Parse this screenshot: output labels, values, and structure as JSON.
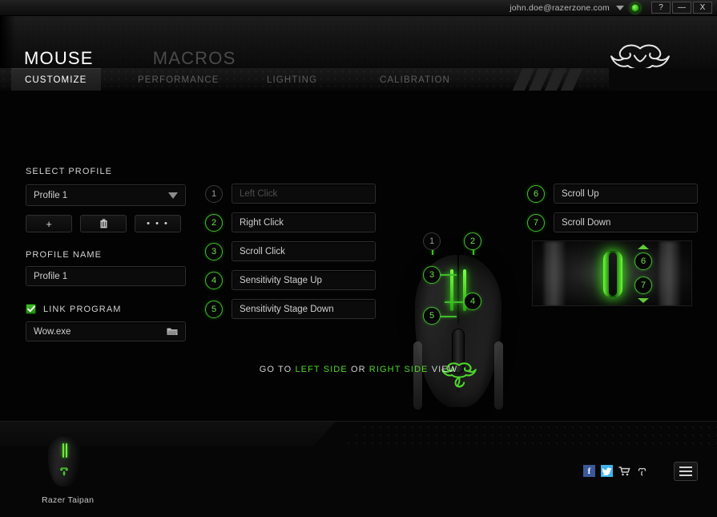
{
  "titlebar": {
    "email": "john.doe@razerzone.com",
    "caret_icon": "chevron-down-icon",
    "status_icon": "online-status-indicator",
    "help_label": "?",
    "minimize_label": "—",
    "close_label": "X"
  },
  "header": {
    "main_tabs": [
      {
        "label": "MOUSE",
        "active": true
      },
      {
        "label": "MACROS",
        "active": false
      }
    ],
    "logo_icon": "razer-logo-icon"
  },
  "sub_tabs": [
    {
      "label": "CUSTOMIZE",
      "active": true
    },
    {
      "label": "PERFORMANCE",
      "active": false
    },
    {
      "label": "LIGHTING",
      "active": false
    },
    {
      "label": "CALIBRATION",
      "active": false
    }
  ],
  "profile_panel": {
    "select_profile_label": "SELECT PROFILE",
    "selected_profile": "Profile 1",
    "add_button_label": "+",
    "delete_button_icon": "trash-icon",
    "more_button_label": "• • •",
    "profile_name_label": "PROFILE NAME",
    "profile_name_value": "Profile 1",
    "link_program_label": "LINK PROGRAM",
    "link_program_checked": true,
    "linked_program_value": "Wow.exe",
    "browse_icon": "folder-icon"
  },
  "assignments_left": [
    {
      "number": "1",
      "label": "Left Click",
      "dim": true
    },
    {
      "number": "2",
      "label": "Right Click",
      "dim": false
    },
    {
      "number": "3",
      "label": "Scroll Click",
      "dim": false
    },
    {
      "number": "4",
      "label": "Sensitivity Stage Up",
      "dim": false
    },
    {
      "number": "5",
      "label": "Sensitivity Stage Down",
      "dim": false
    }
  ],
  "assignments_right": [
    {
      "number": "6",
      "label": "Scroll Up"
    },
    {
      "number": "7",
      "label": "Scroll Down"
    }
  ],
  "mouse_diagram": {
    "badges": [
      "1",
      "2",
      "3",
      "4",
      "5"
    ],
    "logo_icon": "razer-logo-icon"
  },
  "scroll_photo": {
    "badge_up": "6",
    "badge_down": "7",
    "chevron_up_icon": "chevron-up-icon",
    "chevron_down_icon": "chevron-down-icon"
  },
  "goto_view": {
    "prefix": "GO TO",
    "left_link": "LEFT SIDE",
    "separator": "OR",
    "right_link": "RIGHT SIDE",
    "suffix": "VIEW"
  },
  "footer": {
    "device_name": "Razer Taipan",
    "device_thumb_icon": "mouse-thumbnail-icon",
    "social": [
      {
        "icon": "facebook-icon",
        "label": "f"
      },
      {
        "icon": "twitter-icon",
        "label": "t"
      },
      {
        "icon": "cart-icon",
        "label": ""
      },
      {
        "icon": "razer-star-icon",
        "label": ""
      }
    ],
    "menu_icon": "hamburger-menu-icon"
  },
  "colors": {
    "razer_green": "#3fbf2a",
    "link_green": "#4fd62a",
    "background": "#030303",
    "facebook_blue": "#3b5998",
    "twitter_blue": "#3fb3e8"
  }
}
